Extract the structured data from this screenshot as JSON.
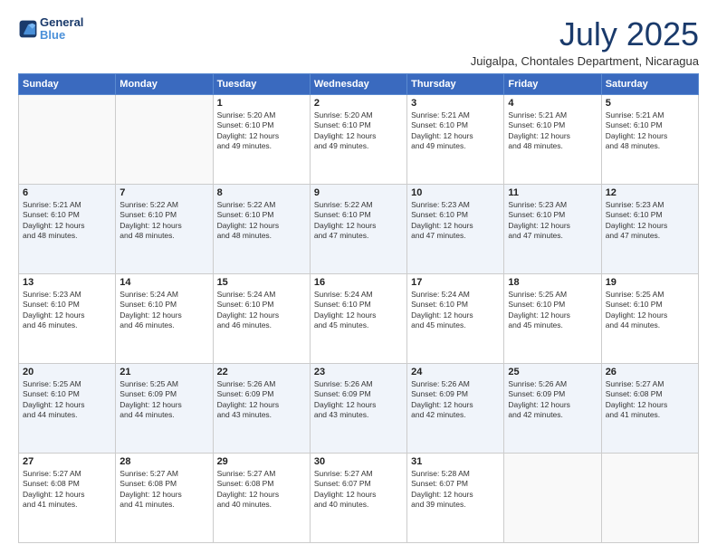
{
  "logo": {
    "line1": "General",
    "line2": "Blue"
  },
  "title": "July 2025",
  "subtitle": "Juigalpa, Chontales Department, Nicaragua",
  "weekdays": [
    "Sunday",
    "Monday",
    "Tuesday",
    "Wednesday",
    "Thursday",
    "Friday",
    "Saturday"
  ],
  "weeks": [
    [
      {
        "day": "",
        "info": ""
      },
      {
        "day": "",
        "info": ""
      },
      {
        "day": "1",
        "info": "Sunrise: 5:20 AM\nSunset: 6:10 PM\nDaylight: 12 hours\nand 49 minutes."
      },
      {
        "day": "2",
        "info": "Sunrise: 5:20 AM\nSunset: 6:10 PM\nDaylight: 12 hours\nand 49 minutes."
      },
      {
        "day": "3",
        "info": "Sunrise: 5:21 AM\nSunset: 6:10 PM\nDaylight: 12 hours\nand 49 minutes."
      },
      {
        "day": "4",
        "info": "Sunrise: 5:21 AM\nSunset: 6:10 PM\nDaylight: 12 hours\nand 48 minutes."
      },
      {
        "day": "5",
        "info": "Sunrise: 5:21 AM\nSunset: 6:10 PM\nDaylight: 12 hours\nand 48 minutes."
      }
    ],
    [
      {
        "day": "6",
        "info": "Sunrise: 5:21 AM\nSunset: 6:10 PM\nDaylight: 12 hours\nand 48 minutes."
      },
      {
        "day": "7",
        "info": "Sunrise: 5:22 AM\nSunset: 6:10 PM\nDaylight: 12 hours\nand 48 minutes."
      },
      {
        "day": "8",
        "info": "Sunrise: 5:22 AM\nSunset: 6:10 PM\nDaylight: 12 hours\nand 48 minutes."
      },
      {
        "day": "9",
        "info": "Sunrise: 5:22 AM\nSunset: 6:10 PM\nDaylight: 12 hours\nand 47 minutes."
      },
      {
        "day": "10",
        "info": "Sunrise: 5:23 AM\nSunset: 6:10 PM\nDaylight: 12 hours\nand 47 minutes."
      },
      {
        "day": "11",
        "info": "Sunrise: 5:23 AM\nSunset: 6:10 PM\nDaylight: 12 hours\nand 47 minutes."
      },
      {
        "day": "12",
        "info": "Sunrise: 5:23 AM\nSunset: 6:10 PM\nDaylight: 12 hours\nand 47 minutes."
      }
    ],
    [
      {
        "day": "13",
        "info": "Sunrise: 5:23 AM\nSunset: 6:10 PM\nDaylight: 12 hours\nand 46 minutes."
      },
      {
        "day": "14",
        "info": "Sunrise: 5:24 AM\nSunset: 6:10 PM\nDaylight: 12 hours\nand 46 minutes."
      },
      {
        "day": "15",
        "info": "Sunrise: 5:24 AM\nSunset: 6:10 PM\nDaylight: 12 hours\nand 46 minutes."
      },
      {
        "day": "16",
        "info": "Sunrise: 5:24 AM\nSunset: 6:10 PM\nDaylight: 12 hours\nand 45 minutes."
      },
      {
        "day": "17",
        "info": "Sunrise: 5:24 AM\nSunset: 6:10 PM\nDaylight: 12 hours\nand 45 minutes."
      },
      {
        "day": "18",
        "info": "Sunrise: 5:25 AM\nSunset: 6:10 PM\nDaylight: 12 hours\nand 45 minutes."
      },
      {
        "day": "19",
        "info": "Sunrise: 5:25 AM\nSunset: 6:10 PM\nDaylight: 12 hours\nand 44 minutes."
      }
    ],
    [
      {
        "day": "20",
        "info": "Sunrise: 5:25 AM\nSunset: 6:10 PM\nDaylight: 12 hours\nand 44 minutes."
      },
      {
        "day": "21",
        "info": "Sunrise: 5:25 AM\nSunset: 6:09 PM\nDaylight: 12 hours\nand 44 minutes."
      },
      {
        "day": "22",
        "info": "Sunrise: 5:26 AM\nSunset: 6:09 PM\nDaylight: 12 hours\nand 43 minutes."
      },
      {
        "day": "23",
        "info": "Sunrise: 5:26 AM\nSunset: 6:09 PM\nDaylight: 12 hours\nand 43 minutes."
      },
      {
        "day": "24",
        "info": "Sunrise: 5:26 AM\nSunset: 6:09 PM\nDaylight: 12 hours\nand 42 minutes."
      },
      {
        "day": "25",
        "info": "Sunrise: 5:26 AM\nSunset: 6:09 PM\nDaylight: 12 hours\nand 42 minutes."
      },
      {
        "day": "26",
        "info": "Sunrise: 5:27 AM\nSunset: 6:08 PM\nDaylight: 12 hours\nand 41 minutes."
      }
    ],
    [
      {
        "day": "27",
        "info": "Sunrise: 5:27 AM\nSunset: 6:08 PM\nDaylight: 12 hours\nand 41 minutes."
      },
      {
        "day": "28",
        "info": "Sunrise: 5:27 AM\nSunset: 6:08 PM\nDaylight: 12 hours\nand 41 minutes."
      },
      {
        "day": "29",
        "info": "Sunrise: 5:27 AM\nSunset: 6:08 PM\nDaylight: 12 hours\nand 40 minutes."
      },
      {
        "day": "30",
        "info": "Sunrise: 5:27 AM\nSunset: 6:07 PM\nDaylight: 12 hours\nand 40 minutes."
      },
      {
        "day": "31",
        "info": "Sunrise: 5:28 AM\nSunset: 6:07 PM\nDaylight: 12 hours\nand 39 minutes."
      },
      {
        "day": "",
        "info": ""
      },
      {
        "day": "",
        "info": ""
      }
    ]
  ]
}
